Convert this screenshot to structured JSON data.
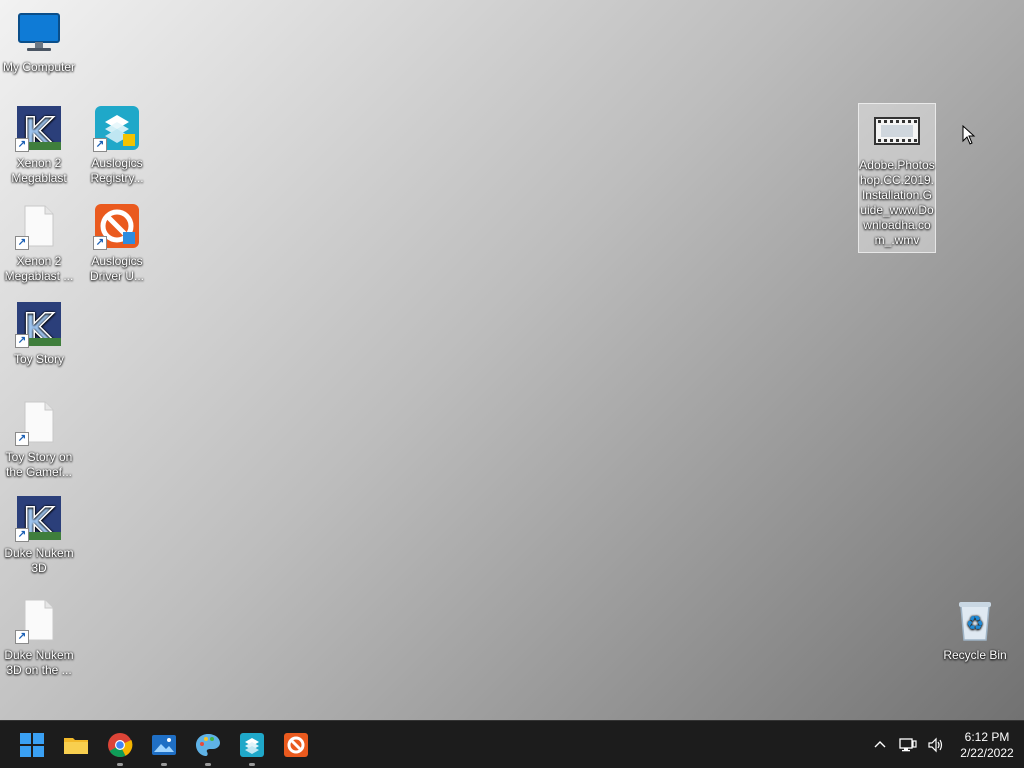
{
  "desktop": {
    "icons": [
      {
        "label": "My Computer"
      },
      {
        "label": "Xenon 2 Megablast"
      },
      {
        "label": "Auslogics Registry..."
      },
      {
        "label": "Xenon 2 Megablast ..."
      },
      {
        "label": "Auslogics Driver U..."
      },
      {
        "label": "Toy Story"
      },
      {
        "label": "Toy Story on the Gamef..."
      },
      {
        "label": "Duke Nukem 3D"
      },
      {
        "label": "Duke Nukem 3D on the ..."
      },
      {
        "label": "Adobe.Photoshop.CC.2019.Installation.Guide_www.Downloadha.com_.wmv"
      },
      {
        "label": "Recycle Bin"
      }
    ]
  },
  "taskbar": {
    "apps": [
      "start-icon",
      "file-explorer-icon",
      "chrome-icon",
      "photos-icon",
      "paint-icon",
      "auslogics-registry-icon",
      "auslogics-driver-icon"
    ]
  },
  "clock": {
    "time": "6:12 PM",
    "date": "2/22/2022"
  }
}
